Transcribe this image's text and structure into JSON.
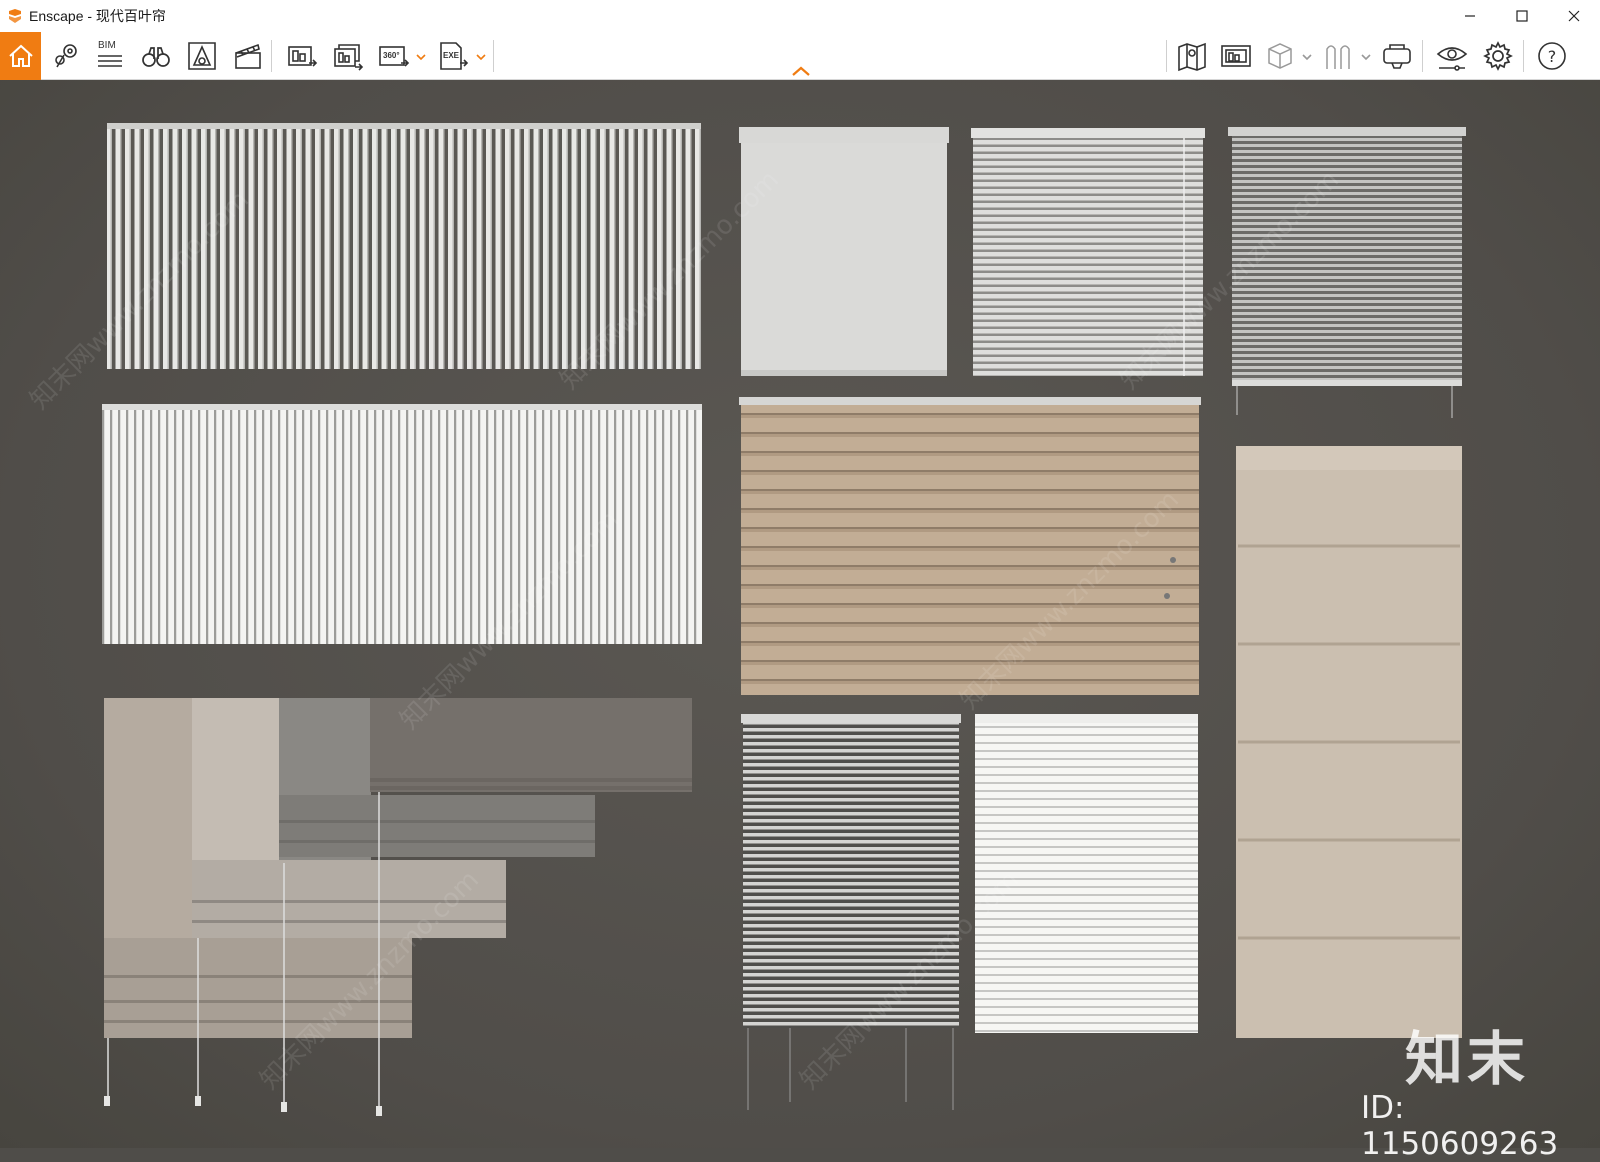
{
  "window": {
    "app_name": "Enscape",
    "title": "Enscape - 现代百叶帘",
    "controls": [
      "minimize-icon",
      "maximize-icon",
      "close-icon"
    ]
  },
  "toolbar": {
    "accent_color": "#f07c12",
    "left_buttons": [
      {
        "name": "home",
        "icon": "home-icon"
      },
      {
        "name": "views",
        "icon": "location-views-icon"
      },
      {
        "name": "bim",
        "icon": "bim-icon",
        "label": "BIM"
      },
      {
        "name": "binoculars",
        "icon": "binoculars-icon"
      },
      {
        "name": "asset-library",
        "icon": "asset-library-icon"
      },
      {
        "name": "video-editor",
        "icon": "clapperboard-icon"
      },
      {
        "name": "screenshot",
        "icon": "screenshot-icon"
      },
      {
        "name": "batch-render",
        "icon": "batch-render-icon"
      },
      {
        "name": "panorama",
        "icon": "panorama-icon",
        "label": "360°"
      },
      {
        "name": "export-exe",
        "icon": "export-exe-icon",
        "label": "EXE"
      }
    ],
    "right_buttons": [
      {
        "name": "map",
        "icon": "map-icon"
      },
      {
        "name": "views-panel",
        "icon": "views-panel-icon"
      },
      {
        "name": "cube",
        "icon": "cube-icon"
      },
      {
        "name": "material",
        "icon": "material-icon"
      },
      {
        "name": "vr",
        "icon": "vr-headset-icon"
      },
      {
        "name": "visual-settings",
        "icon": "eye-settings-icon"
      },
      {
        "name": "settings",
        "icon": "gear-icon"
      },
      {
        "name": "help",
        "icon": "help-icon",
        "label": "?"
      }
    ]
  },
  "watermark": {
    "logo": "知末",
    "id": "ID: 1150609263",
    "diagonal": "知末网www.znzmo.com"
  }
}
